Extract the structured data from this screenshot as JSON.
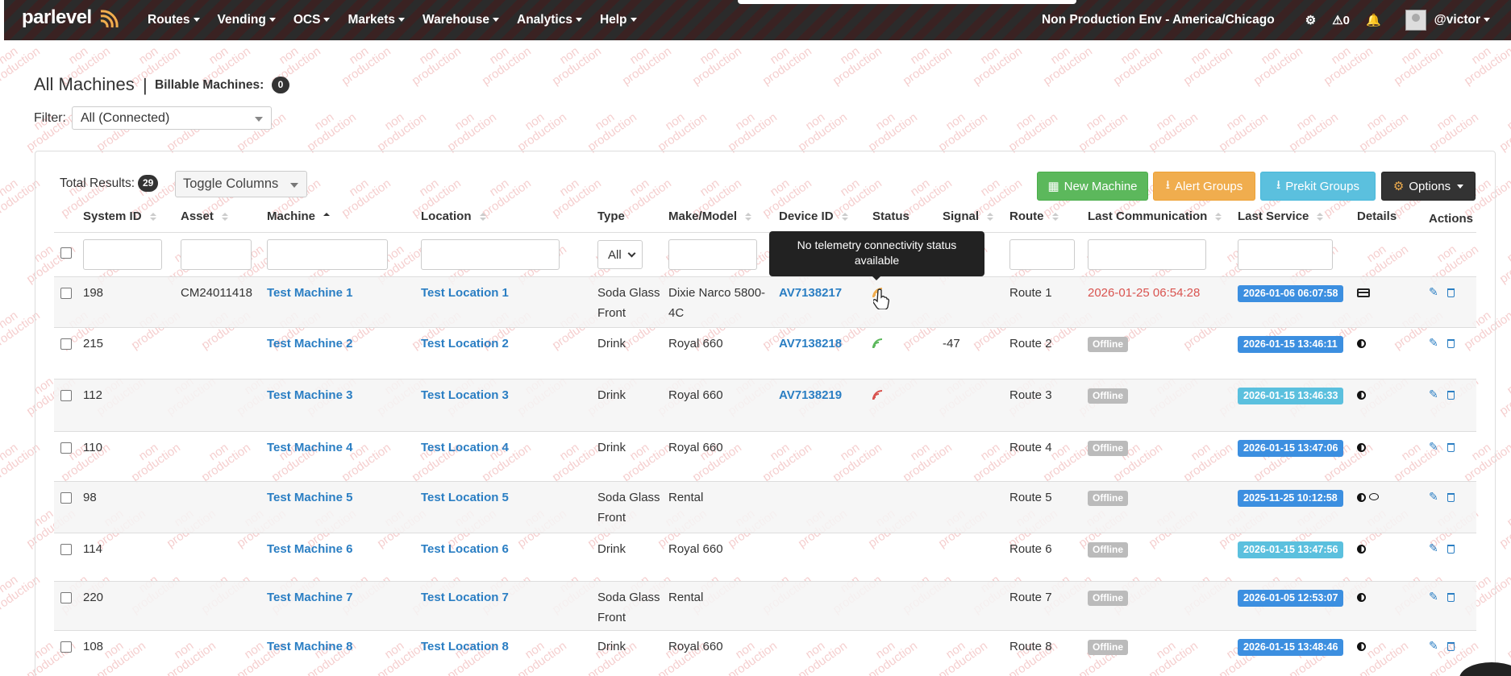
{
  "nav": {
    "logo": "parlevel",
    "menu": [
      "Routes",
      "Vending",
      "OCS",
      "Markets",
      "Warehouse",
      "Analytics",
      "Help"
    ],
    "environment": "Non Production Env - America/Chicago",
    "alert_count": "0",
    "username": "@victor"
  },
  "watermark_text": "non production",
  "page": {
    "title": "All Machines",
    "separator": "|",
    "billable_label": "Billable Machines:",
    "billable_count": "0",
    "filter_label": "Filter:",
    "filter_value": "All (Connected)"
  },
  "toolbar": {
    "total_label": "Total Results:",
    "total_count": "29",
    "toggle_columns": "Toggle Columns",
    "new_machine": "New Machine",
    "alert_groups": "Alert Groups",
    "prekit_groups": "Prekit Groups",
    "options": "Options"
  },
  "columns": [
    "System ID",
    "Asset",
    "Machine",
    "Location",
    "Type",
    "Make/Model",
    "Device ID",
    "Status",
    "Signal",
    "Route",
    "Last Communication",
    "Last Service",
    "Details",
    "Actions"
  ],
  "type_filter": "All",
  "tooltip": "No telemetry connectivity status available",
  "rows": [
    {
      "system_id": "198",
      "asset": "CM24011418",
      "machine": "Test Machine 1",
      "location": "Test Location 1",
      "type": [
        "Soda Glass",
        "Front"
      ],
      "make": [
        "Dixie Narco 5800-",
        "4C"
      ],
      "device_id": "AV7138217",
      "status": "orange",
      "signal": "",
      "route": "Route 1",
      "last_comm": "2026-01-25 06:54:28",
      "last_service": "2026-01-06 06:07:58",
      "service_color": "blue",
      "details": [
        "card"
      ]
    },
    {
      "system_id": "215",
      "asset": "",
      "machine": "Test Machine 2",
      "location": "Test Location 2",
      "type": [
        "Drink"
      ],
      "make": [
        "Royal 660"
      ],
      "device_id": "AV7138218",
      "status": "green",
      "signal": "-47",
      "route": "Route 2",
      "last_comm": "Offline",
      "last_service": "2026-01-15 13:46:11",
      "service_color": "blue",
      "details": [
        "halfmoon"
      ]
    },
    {
      "system_id": "112",
      "asset": "",
      "machine": "Test Machine 3",
      "location": "Test Location 3",
      "type": [
        "Drink"
      ],
      "make": [
        "Royal 660"
      ],
      "device_id": "AV7138219",
      "status": "red",
      "signal": "",
      "route": "Route 3",
      "last_comm": "Offline",
      "last_service": "2026-01-15 13:46:33",
      "service_color": "cyan",
      "details": [
        "halfmoon"
      ]
    },
    {
      "system_id": "110",
      "asset": "",
      "machine": "Test Machine 4",
      "location": "Test Location 4",
      "type": [
        "Drink"
      ],
      "make": [
        "Royal 660"
      ],
      "device_id": "",
      "status": "",
      "signal": "",
      "route": "Route 4",
      "last_comm": "Offline",
      "last_service": "2026-01-15 13:47:06",
      "service_color": "blue",
      "details": [
        "halfmoon"
      ]
    },
    {
      "system_id": "98",
      "asset": "",
      "machine": "Test Machine 5",
      "location": "Test Location 5",
      "type": [
        "Soda Glass",
        "Front"
      ],
      "make": [
        "Rental"
      ],
      "device_id": "",
      "status": "",
      "signal": "",
      "route": "Route 5",
      "last_comm": "Offline",
      "last_service": "2025-11-25 10:12:58",
      "service_color": "blue",
      "details": [
        "halfmoon",
        "bubble"
      ]
    },
    {
      "system_id": "114",
      "asset": "",
      "machine": "Test Machine 6",
      "location": "Test Location 6",
      "type": [
        "Drink"
      ],
      "make": [
        "Royal 660"
      ],
      "device_id": "",
      "status": "",
      "signal": "",
      "route": "Route 6",
      "last_comm": "Offline",
      "last_service": "2026-01-15 13:47:56",
      "service_color": "cyan",
      "details": [
        "halfmoon"
      ]
    },
    {
      "system_id": "220",
      "asset": "",
      "machine": "Test Machine 7",
      "location": "Test Location 7",
      "type": [
        "Soda Glass",
        "Front"
      ],
      "make": [
        "Rental"
      ],
      "device_id": "",
      "status": "",
      "signal": "",
      "route": "Route 7",
      "last_comm": "Offline",
      "last_service": "2026-01-05 12:53:07",
      "service_color": "blue",
      "details": [
        "halfmoon"
      ]
    },
    {
      "system_id": "108",
      "asset": "",
      "machine": "Test Machine 8",
      "location": "Test Location 8",
      "type": [
        "Drink"
      ],
      "make": [
        "Royal 660"
      ],
      "device_id": "",
      "status": "",
      "signal": "",
      "route": "Route 8",
      "last_comm": "Offline",
      "last_service": "2026-01-15 13:48:46",
      "service_color": "blue",
      "details": [
        "halfmoon"
      ]
    }
  ],
  "colors": {
    "link": "#2a7ec3",
    "status_orange": "#f0ad4e",
    "status_green": "#5cb85c",
    "status_red": "#d9534f",
    "service_blue": "#3c8fe0",
    "service_cyan": "#5bc0de",
    "offline": "#bbbbbb"
  }
}
